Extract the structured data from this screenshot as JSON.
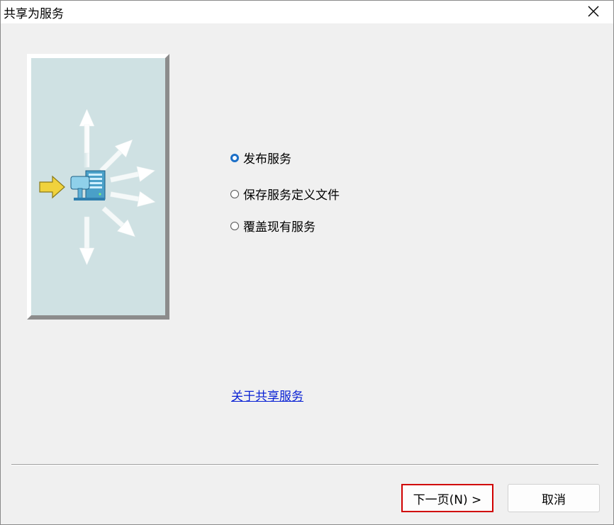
{
  "dialog": {
    "title": "共享为服务",
    "close_icon": "close-icon"
  },
  "illustration": {
    "icon": "publish-service-illustration"
  },
  "options": [
    {
      "label": "发布服务",
      "checked": true
    },
    {
      "label": "保存服务定义文件",
      "checked": false
    },
    {
      "label": "覆盖现有服务",
      "checked": false
    }
  ],
  "link": {
    "label": "关于共享服务"
  },
  "buttons": {
    "next_label": "下一页(N) >",
    "cancel_label": "取消"
  },
  "colors": {
    "accent": "#1c6fc7",
    "link": "#0a22d4",
    "highlight_border": "#d00000",
    "panel": "#cfe1e3"
  }
}
